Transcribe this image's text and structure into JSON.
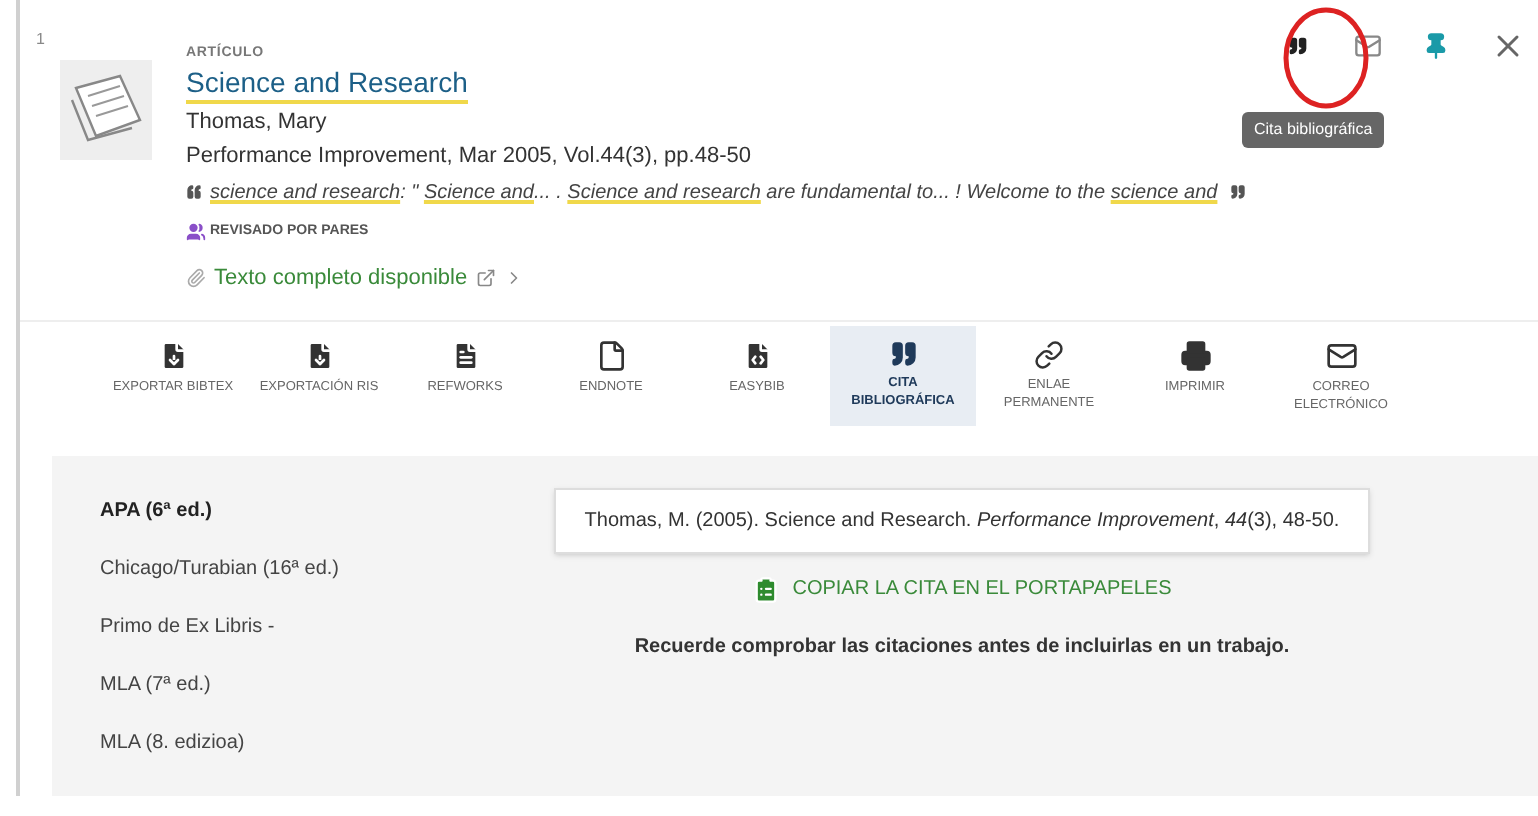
{
  "result": {
    "number": "1",
    "type": "ARTÍCULO",
    "title": "Science and Research",
    "author": "Thomas, Mary",
    "source": "Performance Improvement, Mar 2005, Vol.44(3), pp.48-50",
    "snippet": [
      {
        "text": "science and research",
        "highlight": true
      },
      {
        "text": ": \" ",
        "highlight": false
      },
      {
        "text": "Science and",
        "highlight": true
      },
      {
        "text": "... . ",
        "highlight": false
      },
      {
        "text": "Science and research",
        "highlight": true
      },
      {
        "text": " are fundamental to... ! Welcome to the ",
        "highlight": false
      },
      {
        "text": "science and",
        "highlight": true
      }
    ],
    "peer_reviewed": "REVISADO POR PARES",
    "full_text": "Texto completo disponible"
  },
  "top_actions": {
    "tooltip": "Cita bibliográfica",
    "annotation_circle": true
  },
  "actions": [
    {
      "kind": "bibtex",
      "label": "EXPORTAR BIBTEX",
      "selected": false
    },
    {
      "kind": "ris",
      "label": "EXPORTACIÓN RIS",
      "selected": false
    },
    {
      "kind": "refworks",
      "label": "REFWORKS",
      "selected": false
    },
    {
      "kind": "endnote",
      "label": "ENDNOTE",
      "selected": false
    },
    {
      "kind": "easybib",
      "label": "EASYBIB",
      "selected": false
    },
    {
      "kind": "cite",
      "label": "CITA BIBLIOGRÁFICA",
      "selected": true
    },
    {
      "kind": "link",
      "label": "ENLAE PERMANENTE",
      "selected": false
    },
    {
      "kind": "print",
      "label": "IMPRIMIR",
      "selected": false
    },
    {
      "kind": "email",
      "label": "CORREO ELECTRÓNICO",
      "selected": false
    }
  ],
  "citation": {
    "styles": [
      {
        "label": "APA (6ª ed.)",
        "selected": true
      },
      {
        "label": "Chicago/Turabian (16ª ed.)",
        "selected": false
      },
      {
        "label": "Primo de Ex Libris -",
        "selected": false
      },
      {
        "label": "MLA (7ª ed.)",
        "selected": false
      },
      {
        "label": "MLA (8. edizioa)",
        "selected": false
      }
    ],
    "text": "Thomas, M. (2005). Science and Research. *Performance Improvement*, *44*(3), 48-50.",
    "copy_button": "COPIAR LA CITA EN EL PORTAPAPELES",
    "note": "Recuerde comprobar las citaciones antes de incluirlas en un trabajo."
  }
}
